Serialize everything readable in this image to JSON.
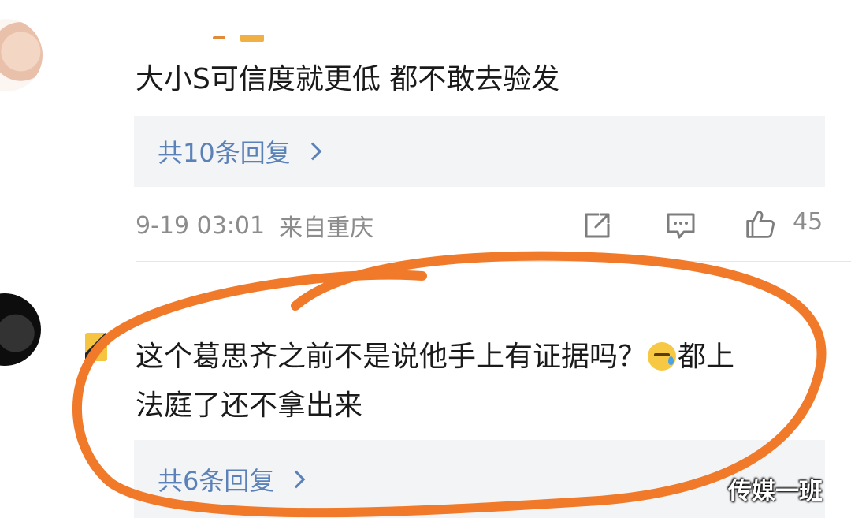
{
  "comments": [
    {
      "text": "大小S可信度就更低 都不敢去验发",
      "reply_summary": "共10条回复",
      "timestamp": "9-19 03:01",
      "location": "来自重庆",
      "like_count": "45",
      "actions": [
        "share-icon",
        "comment-icon",
        "like-icon"
      ]
    },
    {
      "text_line1": "这个葛思齐之前不是说他手上有证据吗？",
      "text_line1_cont": "都上",
      "text_line2": "法庭了还不拿出来",
      "emoji": "sweat-emoji",
      "reply_summary": "共6条回复"
    }
  ],
  "watermark": "传媒一班",
  "colors": {
    "link": "#5b82b8",
    "meta": "#8c8c8c",
    "reply_bg": "#f3f4f6",
    "annotation": "#f07a2a"
  }
}
